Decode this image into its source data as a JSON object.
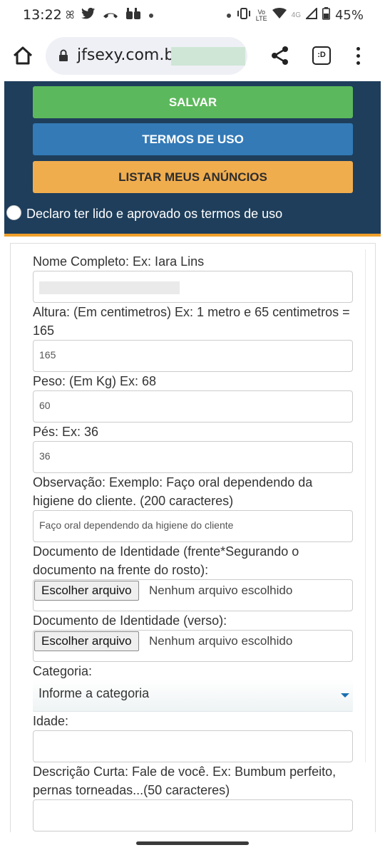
{
  "status_bar": {
    "time": "13:22",
    "battery": "45%",
    "network": "4G",
    "left_icons": [
      "notification-icon",
      "twitter-icon",
      "missed-call-icon",
      "quote-icon",
      "dot-icon"
    ],
    "right_icons": [
      "dot-icon",
      "vibrate-icon",
      "volte-icon",
      "wifi-icon",
      "signal-icon",
      "battery-icon"
    ]
  },
  "browser": {
    "url": "jfsexy.com.br/",
    "tabs_label": ":D"
  },
  "top_panel": {
    "save_label": "SALVAR",
    "terms_label": "TERMOS DE USO",
    "list_label": "LISTAR MEUS ANÚNCIOS",
    "agree_label": "Declaro ter lido e aprovado os termos de uso",
    "colors": {
      "panel": "#1e3e5b",
      "save": "#5cb85c",
      "terms": "#337ab7",
      "list": "#f0ad4e",
      "accent": "#f0a02a"
    }
  },
  "form": {
    "name_label": "Nome Completo: Ex: Iara Lins",
    "height_label": "Altura: (Em centimetros) Ex: 1 metro e 65 centimetros = 165",
    "height_value": "165",
    "weight_label": "Peso: (Em Kg) Ex: 68",
    "weight_value": "60",
    "feet_label": "Pés: Ex: 36",
    "feet_value": "36",
    "obs_label": "Observação: Exemplo: Faço oral dependendo da higiene do cliente. (200 caracteres)",
    "obs_value": "Faço oral dependendo da higiene do cliente",
    "doc_front_label": "Documento de Identidade (frente*Segurando o documento na frente do rosto):",
    "doc_back_label": "Documento de Identidade (verso):",
    "file_button": "Escolher arquivo",
    "file_status": "Nenhum arquivo escolhido",
    "category_label": "Categoria:",
    "category_value": "Informe a categoria",
    "age_label": "Idade:",
    "short_desc_label": "Descrição Curta: Fale de você. Ex: Bumbum perfeito, pernas torneadas...(50 caracteres)"
  }
}
